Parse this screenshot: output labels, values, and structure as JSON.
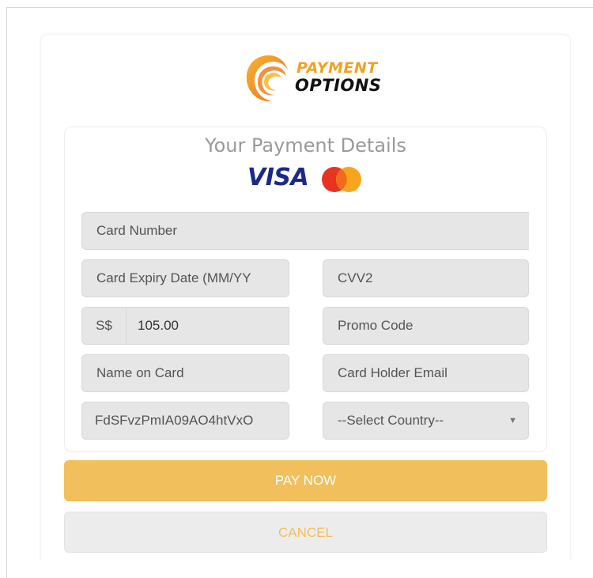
{
  "logo": {
    "line1": "PAYMENT",
    "line2": "OPTIONS"
  },
  "form": {
    "title": "Your Payment Details",
    "brands": {
      "visa": "VISA",
      "mastercard": "mastercard"
    },
    "card_number": {
      "placeholder": "Card Number",
      "value": ""
    },
    "expiry": {
      "placeholder": "Card Expiry Date (MM/YY",
      "value": ""
    },
    "cvv": {
      "placeholder": "CVV2",
      "value": ""
    },
    "currency_prefix": "S$",
    "amount": "105.00",
    "promo": {
      "placeholder": "Promo Code",
      "value": ""
    },
    "name_on_card": {
      "placeholder": "Name on Card",
      "value": ""
    },
    "email": {
      "placeholder": "Card Holder Email",
      "value": ""
    },
    "reference": "FdSFvzPmIA09AO4htVxO",
    "country": {
      "selected": "--Select Country--"
    }
  },
  "actions": {
    "pay_label": "PAY NOW",
    "cancel_label": "CANCEL"
  },
  "colors": {
    "accent": "#f2bf5d",
    "visa_blue": "#1a2a8c",
    "field_bg": "#e6e6e6"
  },
  "icons": {
    "dropdown": "caret-down-icon",
    "mastercard": "mastercard-icon",
    "logo": "swirl-logo-icon"
  }
}
